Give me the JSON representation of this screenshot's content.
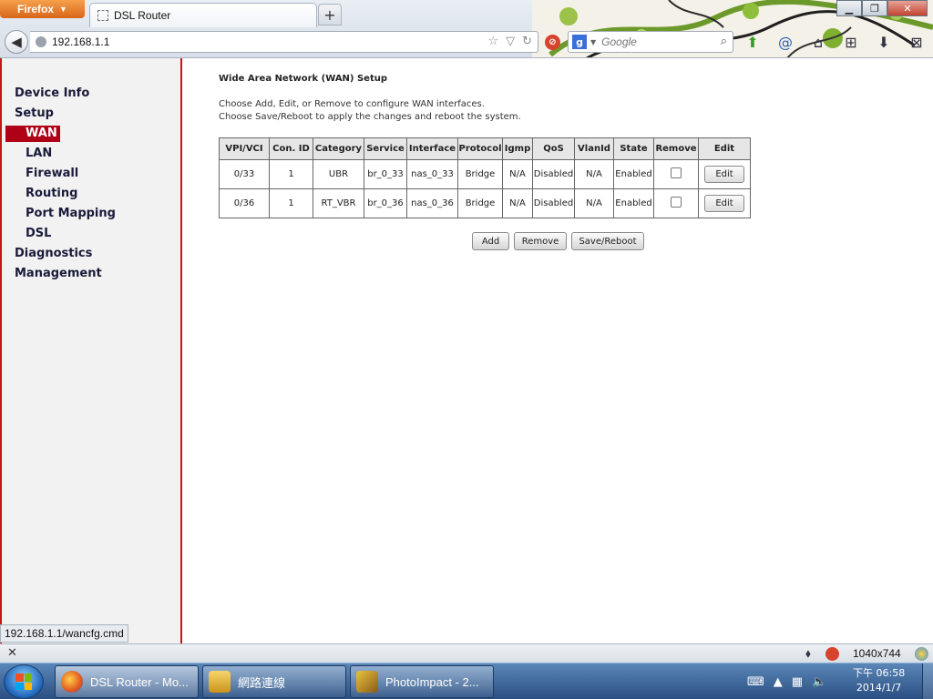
{
  "browser": {
    "app_button": "Firefox",
    "tab_title": "DSL Router",
    "url": "192.168.1.1",
    "search_placeholder": "Google",
    "status_url": "192.168.1.1/wancfg.cmd",
    "addon_resolution": "1040x744"
  },
  "sidebar": {
    "items": [
      {
        "label": "Device Info",
        "level": "top"
      },
      {
        "label": "Setup",
        "level": "top"
      },
      {
        "label": "WAN",
        "level": "sub",
        "selected": true
      },
      {
        "label": "LAN",
        "level": "sub"
      },
      {
        "label": "Firewall",
        "level": "sub"
      },
      {
        "label": "Routing",
        "level": "sub"
      },
      {
        "label": "Port Mapping",
        "level": "sub"
      },
      {
        "label": "DSL",
        "level": "sub"
      },
      {
        "label": "Diagnostics",
        "level": "top"
      },
      {
        "label": "Management",
        "level": "top"
      }
    ]
  },
  "main": {
    "title": "Wide Area Network (WAN) Setup",
    "desc_line1": "Choose Add, Edit, or Remove to configure WAN interfaces.",
    "desc_line2": "Choose Save/Reboot to apply the changes and reboot the system.",
    "table": {
      "headers": [
        "VPI/VCI",
        "Con. ID",
        "Category",
        "Service",
        "Interface",
        "Protocol",
        "Igmp",
        "QoS",
        "VlanId",
        "State",
        "Remove",
        "Edit"
      ],
      "rows": [
        [
          "0/33",
          "1",
          "UBR",
          "br_0_33",
          "nas_0_33",
          "Bridge",
          "N/A",
          "Disabled",
          "N/A",
          "Enabled"
        ],
        [
          "0/36",
          "1",
          "RT_VBR",
          "br_0_36",
          "nas_0_36",
          "Bridge",
          "N/A",
          "Disabled",
          "N/A",
          "Enabled"
        ]
      ],
      "edit_label": "Edit"
    },
    "buttons": {
      "add": "Add",
      "remove": "Remove",
      "save_reboot": "Save/Reboot"
    }
  },
  "taskbar": {
    "tasks": [
      {
        "label": "DSL Router - Mo...",
        "icon": "firefox-icon"
      },
      {
        "label": "網路連線",
        "icon": "network-connections-icon"
      },
      {
        "label": "PhotoImpact - 2...",
        "icon": "photoimpact-icon"
      }
    ],
    "clock_time": "下午 06:58",
    "clock_date": "2014/1/7"
  },
  "colors": {
    "sidebar_accent": "#c01818",
    "selected_menu_bg": "#b00018",
    "taskbar": "#3a6294"
  }
}
